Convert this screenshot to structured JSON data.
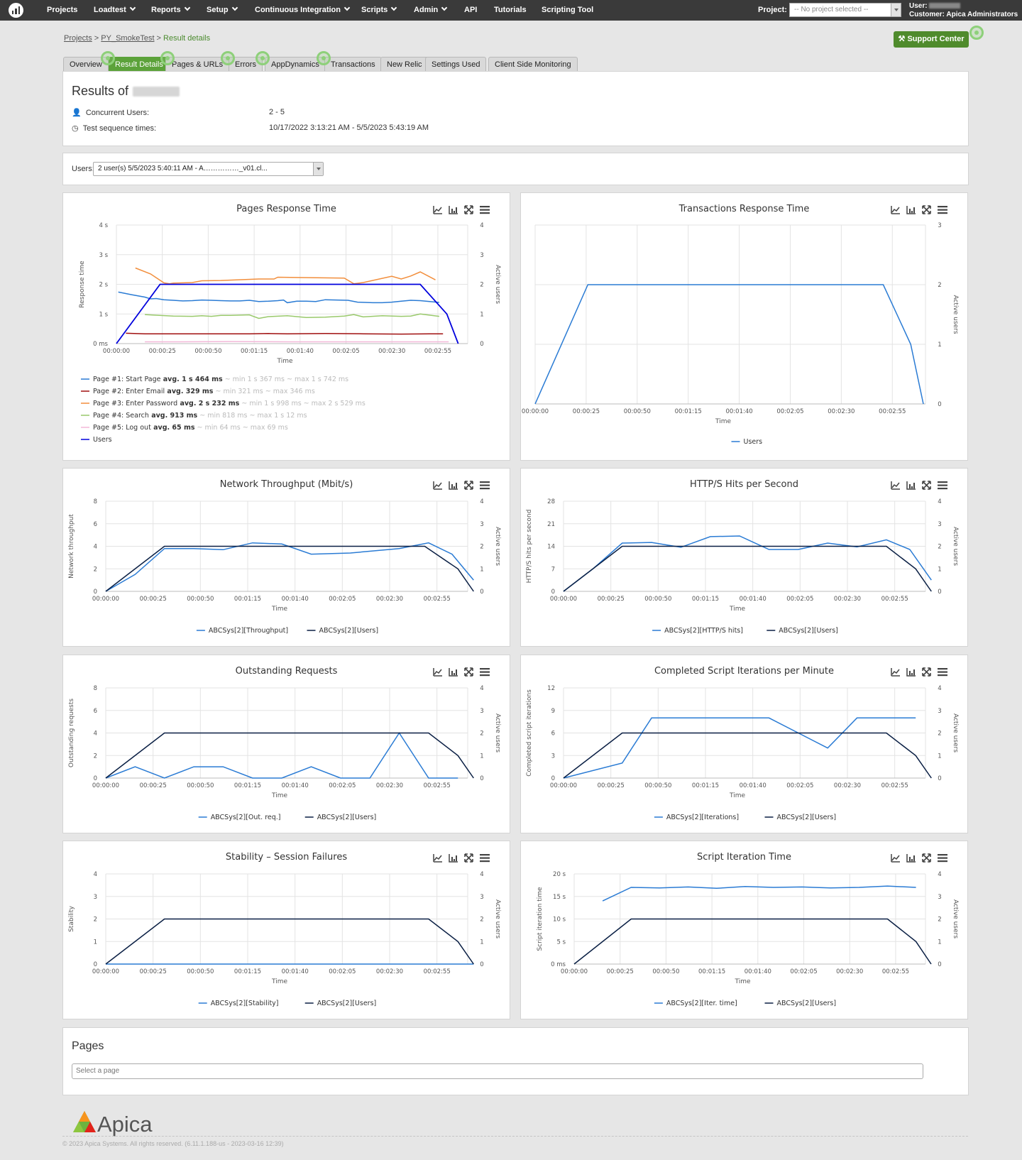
{
  "topnav": {
    "items": [
      "Projects",
      "Loadtest",
      "Reports",
      "Setup",
      "Continuous Integration",
      "Scripts",
      "Admin",
      "API",
      "Tutorials",
      "Scripting Tool"
    ],
    "project_label": "Project:",
    "project_value": "-- No project selected --",
    "user_label": "User:",
    "customer_label": "Customer: Apica Administrators"
  },
  "breadcrumb": {
    "projects": "Projects",
    "sep1": " > ",
    "test": "PY_SmokeTest",
    "sep2": " > ",
    "current": "Result details"
  },
  "support_button": "Support Center",
  "tabs": [
    "Overview",
    "Result Details",
    "Pages & URLs",
    "Errors",
    "AppDynamics",
    "Transactions",
    "New Relic",
    "Settings Used",
    "Client Side Monitoring"
  ],
  "active_tab": "Result Details",
  "results": {
    "title": "Results of",
    "concurrent_label": "Concurrent Users:",
    "concurrent_value": "2 - 5",
    "times_label": "Test sequence times:",
    "times_value": "10/17/2022 3:13:21 AM - 5/5/2023 5:43:19 AM"
  },
  "users_selector": {
    "label": "Users:",
    "value": "2 user(s) 5/5/2023 5:40:11 AM - A……………_v01.cl..."
  },
  "colors": {
    "blue": "#2a7bd4",
    "navy": "#0a1f44",
    "users_bright": "#0000dd",
    "red": "#a01010",
    "orange": "#f28e3c",
    "green": "#99c96b",
    "pink": "#f2b8d8",
    "green_brand": "#5ca23a"
  },
  "chart_icons": [
    "line-chart-icon",
    "bar-chart-icon",
    "expand-icon",
    "menu-icon"
  ],
  "chart_data": [
    {
      "id": "pages",
      "type": "line",
      "title": "Pages Response Time",
      "xlabel": "Time",
      "ylabel": "Response time",
      "y2label": "Active users",
      "x_ticks": [
        "00:00:00",
        "00:00:25",
        "00:00:50",
        "00:01:15",
        "00:01:40",
        "00:02:05",
        "00:02:30",
        "00:02:55"
      ],
      "x_range": [
        0,
        185
      ],
      "y_ticks": [
        "0 ms",
        "1 s",
        "2 s",
        "3 s",
        "4 s"
      ],
      "ylim": [
        0,
        4
      ],
      "y2_ticks": [
        "0",
        "1",
        "2",
        "3",
        "4"
      ],
      "y2lim": [
        0,
        4
      ],
      "series": [
        {
          "name": "Page #1: Start Page",
          "stats": {
            "avg": "avg. 1 s 464 ms",
            "min": "~ min 1 s 367 ms",
            "max": "~ max 1 s 742 ms"
          },
          "color": "#2a7bd4",
          "axis": "y",
          "x": [
            1,
            8,
            15,
            18,
            21,
            25,
            30,
            35,
            40,
            45,
            50,
            55,
            60,
            65,
            70,
            75,
            80,
            85,
            88,
            90,
            95,
            100,
            105,
            110,
            122,
            127,
            135,
            140,
            145,
            150,
            155,
            160,
            165,
            170
          ],
          "y": [
            1.74,
            1.65,
            1.57,
            1.51,
            1.52,
            1.48,
            1.46,
            1.44,
            1.45,
            1.47,
            1.46,
            1.45,
            1.44,
            1.44,
            1.46,
            1.42,
            1.43,
            1.45,
            1.47,
            1.38,
            1.43,
            1.43,
            1.42,
            1.48,
            1.46,
            1.4,
            1.38,
            1.38,
            1.4,
            1.43,
            1.46,
            1.45,
            1.42,
            1.39
          ]
        },
        {
          "name": "Page #2: Enter Email",
          "stats": {
            "avg": "avg. 329 ms",
            "min": "~ min 321 ms",
            "max": "~ max 346 ms"
          },
          "color": "#a01010",
          "axis": "y",
          "x": [
            5,
            15,
            30,
            50,
            70,
            80,
            90,
            110,
            130,
            150,
            165,
            172
          ],
          "y": [
            0.35,
            0.33,
            0.33,
            0.33,
            0.33,
            0.34,
            0.33,
            0.34,
            0.33,
            0.32,
            0.33,
            0.33
          ]
        },
        {
          "name": "Page #3: Enter Password",
          "stats": {
            "avg": "avg. 2 s 232 ms",
            "min": "~ min 1 s 998 ms",
            "max": "~ max 2 s 529 ms"
          },
          "color": "#f28e3c",
          "axis": "y",
          "x": [
            10,
            18,
            25,
            28,
            30,
            40,
            45,
            55,
            75,
            83,
            85,
            95,
            120,
            125,
            130,
            145,
            150,
            155,
            160,
            168
          ],
          "y": [
            2.55,
            2.35,
            2.05,
            2.02,
            2.04,
            2.06,
            2.12,
            2.13,
            2.18,
            2.18,
            2.24,
            2.23,
            2.21,
            2.02,
            2.06,
            2.27,
            2.18,
            2.28,
            2.42,
            2.15
          ]
        },
        {
          "name": "Page #4: Search",
          "stats": {
            "avg": "avg. 913 ms",
            "min": "~ min 818 ms",
            "max": "~ max 1 s 12 ms"
          },
          "color": "#99c96b",
          "axis": "y",
          "x": [
            15,
            20,
            30,
            40,
            45,
            50,
            55,
            60,
            65,
            70,
            75,
            80,
            90,
            100,
            110,
            120,
            125,
            130,
            140,
            150,
            155,
            160,
            170
          ],
          "y": [
            0.98,
            0.96,
            0.93,
            0.92,
            0.94,
            0.92,
            0.95,
            0.95,
            0.96,
            0.97,
            0.85,
            0.91,
            0.94,
            0.88,
            0.89,
            0.93,
            0.98,
            0.9,
            0.94,
            0.92,
            0.93,
            1.0,
            0.92
          ]
        },
        {
          "name": "Page #5: Log out",
          "stats": {
            "avg": "avg. 65 ms",
            "min": "~ min 64 ms",
            "max": "~ max 69 ms"
          },
          "color": "#f2b8d8",
          "axis": "y",
          "x": [
            15,
            30,
            60,
            90,
            120,
            150,
            175
          ],
          "y": [
            0.06,
            0.06,
            0.07,
            0.06,
            0.06,
            0.06,
            0.06
          ]
        },
        {
          "name": "Users",
          "color": "#0000dd",
          "axis": "y2",
          "x": [
            0,
            23,
            160,
            174,
            180
          ],
          "y": [
            0,
            2,
            2,
            1,
            0
          ]
        }
      ]
    },
    {
      "id": "trans",
      "type": "line",
      "title": "Transactions Response Time",
      "xlabel": "Time",
      "ylabel": "",
      "y2label": "Active users",
      "x_ticks": [
        "00:00:00",
        "00:00:25",
        "00:00:50",
        "00:01:15",
        "00:01:40",
        "00:02:05",
        "00:02:30",
        "00:02:55"
      ],
      "x_range": [
        0,
        185
      ],
      "y2_ticks": [
        "0",
        "1",
        "2",
        "3"
      ],
      "y2lim": [
        0,
        3
      ],
      "series": [
        {
          "name": "Users",
          "color": "#2a7bd4",
          "axis": "y2",
          "x": [
            0,
            25,
            165,
            178,
            184
          ],
          "y": [
            0,
            2,
            2,
            1,
            0
          ]
        }
      ]
    },
    {
      "id": "network",
      "type": "line",
      "title": "Network Throughput (Mbit/s)",
      "xlabel": "Time",
      "ylabel": "Network throughput",
      "y2label": "Active users",
      "x_ticks": [
        "00:00:00",
        "00:00:25",
        "00:00:50",
        "00:01:15",
        "00:01:40",
        "00:02:05",
        "00:02:30",
        "00:02:55"
      ],
      "x_range": [
        0,
        185
      ],
      "y_ticks": [
        "0",
        "2",
        "4",
        "6",
        "8"
      ],
      "ylim": [
        0,
        8
      ],
      "y2_ticks": [
        "0",
        "1",
        "2",
        "3",
        "4"
      ],
      "y2lim": [
        0,
        4
      ],
      "series": [
        {
          "name": "ABCSys[2][Throughput]",
          "color": "#2a7bd4",
          "axis": "y",
          "x": [
            0,
            15,
            30,
            45,
            60,
            75,
            90,
            105,
            125,
            150,
            165,
            177,
            188
          ],
          "y": [
            0,
            1.5,
            3.8,
            3.8,
            3.7,
            4.3,
            4.2,
            3.3,
            3.4,
            3.8,
            4.3,
            3.3,
            1
          ]
        },
        {
          "name": "ABCSys[2][Users]",
          "color": "#0a1f44",
          "axis": "y2",
          "x": [
            0,
            30,
            163,
            180,
            188
          ],
          "y": [
            0,
            2,
            2,
            1,
            0
          ]
        }
      ]
    },
    {
      "id": "hits",
      "type": "line",
      "title": "HTTP/S Hits per Second",
      "xlabel": "Time",
      "ylabel": "HTTP/S hits per second",
      "y2label": "Active users",
      "x_ticks": [
        "00:00:00",
        "00:00:25",
        "00:00:50",
        "00:01:15",
        "00:01:40",
        "00:02:05",
        "00:02:30",
        "00:02:55"
      ],
      "x_range": [
        0,
        185
      ],
      "y_ticks": [
        "0",
        "7",
        "14",
        "21",
        "28"
      ],
      "ylim": [
        0,
        28
      ],
      "y2_ticks": [
        "0",
        "1",
        "2",
        "3",
        "4"
      ],
      "y2lim": [
        0,
        4
      ],
      "series": [
        {
          "name": "ABCSys[2][HTTP/S hits]",
          "color": "#2a7bd4",
          "axis": "y",
          "x": [
            0,
            15,
            30,
            45,
            60,
            75,
            90,
            105,
            120,
            135,
            150,
            165,
            177,
            188
          ],
          "y": [
            0,
            7,
            15,
            15.2,
            13.7,
            17,
            17.2,
            13,
            13,
            15,
            13.8,
            16,
            13,
            3.5
          ]
        },
        {
          "name": "ABCSys[2][Users]",
          "color": "#0a1f44",
          "axis": "y2",
          "x": [
            0,
            30,
            165,
            180,
            188
          ],
          "y": [
            0,
            2,
            2,
            1,
            0
          ]
        }
      ]
    },
    {
      "id": "outstanding",
      "type": "line",
      "title": "Outstanding Requests",
      "xlabel": "Time",
      "ylabel": "Outstanding requests",
      "y2label": "Active users",
      "x_ticks": [
        "00:00:00",
        "00:00:25",
        "00:00:50",
        "00:01:15",
        "00:01:40",
        "00:02:05",
        "00:02:30",
        "00:02:55"
      ],
      "x_range": [
        0,
        185
      ],
      "y_ticks": [
        "0",
        "2",
        "4",
        "6",
        "8"
      ],
      "ylim": [
        0,
        8
      ],
      "y2_ticks": [
        "0",
        "1",
        "2",
        "3",
        "4"
      ],
      "y2lim": [
        0,
        4
      ],
      "series": [
        {
          "name": "ABCSys[2][Out. req.]",
          "color": "#2a7bd4",
          "axis": "y",
          "x": [
            0,
            15,
            30,
            45,
            60,
            75,
            90,
            105,
            120,
            135,
            150,
            165,
            180
          ],
          "y": [
            0,
            1,
            0,
            1,
            1,
            0,
            0,
            1,
            0,
            0,
            4,
            0,
            0
          ]
        },
        {
          "name": "ABCSys[2][Users]",
          "color": "#0a1f44",
          "axis": "y2",
          "x": [
            0,
            30,
            165,
            180,
            188
          ],
          "y": [
            0,
            2,
            2,
            1,
            0
          ]
        }
      ]
    },
    {
      "id": "iterations",
      "type": "line",
      "title": "Completed Script Iterations per Minute",
      "xlabel": "Time",
      "ylabel": "Completed script iterations",
      "y2label": "Active users",
      "x_ticks": [
        "00:00:00",
        "00:00:25",
        "00:00:50",
        "00:01:15",
        "00:01:40",
        "00:02:05",
        "00:02:30",
        "00:02:55"
      ],
      "x_range": [
        0,
        185
      ],
      "y_ticks": [
        "0",
        "3",
        "6",
        "9",
        "12"
      ],
      "ylim": [
        0,
        12
      ],
      "y2_ticks": [
        "0",
        "1",
        "2",
        "3",
        "4"
      ],
      "y2lim": [
        0,
        4
      ],
      "series": [
        {
          "name": "ABCSys[2][Iterations]",
          "color": "#2a7bd4",
          "axis": "y",
          "x": [
            0,
            30,
            45,
            105,
            135,
            150,
            180
          ],
          "y": [
            0,
            2,
            8,
            8,
            4,
            8,
            8
          ]
        },
        {
          "name": "ABCSys[2][Users]",
          "color": "#0a1f44",
          "axis": "y2",
          "x": [
            0,
            30,
            165,
            180,
            188
          ],
          "y": [
            0,
            2,
            2,
            1,
            0
          ]
        }
      ]
    },
    {
      "id": "stability",
      "type": "line",
      "title": "Stability – Session Failures",
      "xlabel": "Time",
      "ylabel": "Stability",
      "y2label": "Active users",
      "x_ticks": [
        "00:00:00",
        "00:00:25",
        "00:00:50",
        "00:01:15",
        "00:01:40",
        "00:02:05",
        "00:02:30",
        "00:02:55"
      ],
      "x_range": [
        0,
        185
      ],
      "y_ticks": [
        "0",
        "1",
        "2",
        "3",
        "4"
      ],
      "ylim": [
        0,
        4
      ],
      "y2_ticks": [
        "0",
        "1",
        "2",
        "3",
        "4"
      ],
      "y2lim": [
        0,
        4
      ],
      "series": [
        {
          "name": "ABCSys[2][Stability]",
          "color": "#2a7bd4",
          "axis": "y",
          "x": [
            0,
            188
          ],
          "y": [
            0,
            0
          ]
        },
        {
          "name": "ABCSys[2][Users]",
          "color": "#0a1f44",
          "axis": "y2",
          "x": [
            0,
            30,
            165,
            180,
            188
          ],
          "y": [
            0,
            2,
            2,
            1,
            0
          ]
        }
      ]
    },
    {
      "id": "itertime",
      "type": "line",
      "title": "Script Iteration Time",
      "xlabel": "Time",
      "ylabel": "Script iteration time",
      "y2label": "Active users",
      "x_ticks": [
        "00:00:00",
        "00:00:25",
        "00:00:50",
        "00:01:15",
        "00:01:40",
        "00:02:05",
        "00:02:30",
        "00:02:55"
      ],
      "x_range": [
        0,
        185
      ],
      "y_ticks": [
        "0 ms",
        "5 s",
        "10 s",
        "15 s",
        "20 s"
      ],
      "ylim": [
        0,
        20
      ],
      "y2_ticks": [
        "0",
        "1",
        "2",
        "3",
        "4"
      ],
      "y2lim": [
        0,
        4
      ],
      "series": [
        {
          "name": "ABCSys[2][Iter. time]",
          "color": "#2a7bd4",
          "axis": "y",
          "x": [
            15,
            30,
            45,
            60,
            75,
            90,
            105,
            120,
            135,
            150,
            165,
            180
          ],
          "y": [
            14,
            17,
            16.9,
            17.1,
            16.8,
            17.2,
            17,
            17.1,
            16.9,
            17,
            17.3,
            17
          ]
        },
        {
          "name": "ABCSys[2][Users]",
          "color": "#0a1f44",
          "axis": "y2",
          "x": [
            0,
            30,
            165,
            180,
            188
          ],
          "y": [
            0,
            2,
            2,
            1,
            0
          ]
        }
      ]
    }
  ],
  "pages_section": {
    "title": "Pages",
    "placeholder": "Select a page"
  },
  "footer": {
    "brand": "Apica",
    "copyright": "© 2023 Apica Systems. All rights reserved. (6.11.1.188-us - 2023-03-16 12:39)"
  }
}
